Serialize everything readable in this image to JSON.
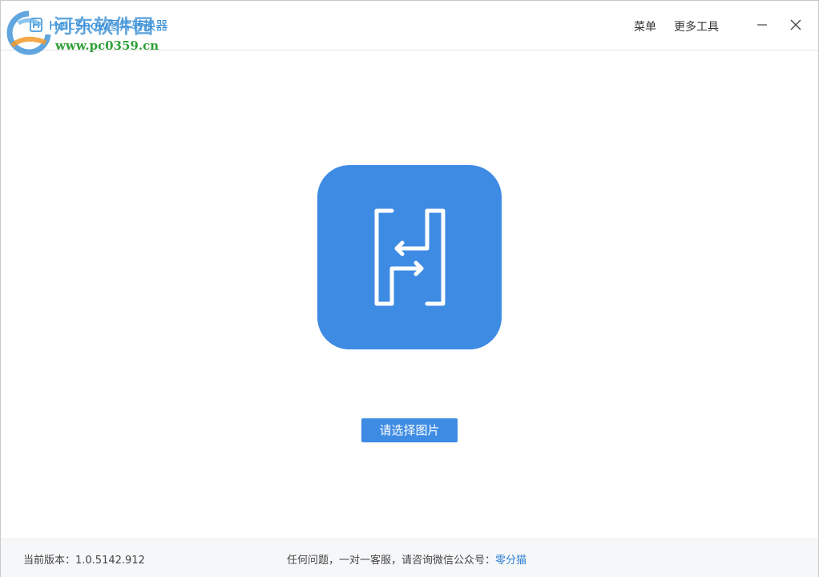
{
  "titlebar": {
    "title": "HeicShow图片转换器",
    "menu_label": "菜单",
    "more_tools_label": "更多工具",
    "minimize_glyph": "—",
    "close_glyph": "✕"
  },
  "watermark": {
    "site_name": "河东软件园",
    "url": "www.pc0359.cn"
  },
  "main": {
    "logo_icon": "heic-convert-logo-icon",
    "select_button_label": "请选择图片"
  },
  "footer": {
    "version_text": "当前版本：1.0.5142.912",
    "support_text": "任何问题，一对一客服，请咨询微信公众号：",
    "support_link": "零分猫"
  },
  "colors": {
    "accent": "#3e8be4",
    "title": "#2d8ad6",
    "footer_bg": "#f6f7f9",
    "link": "#2d7fd3"
  }
}
